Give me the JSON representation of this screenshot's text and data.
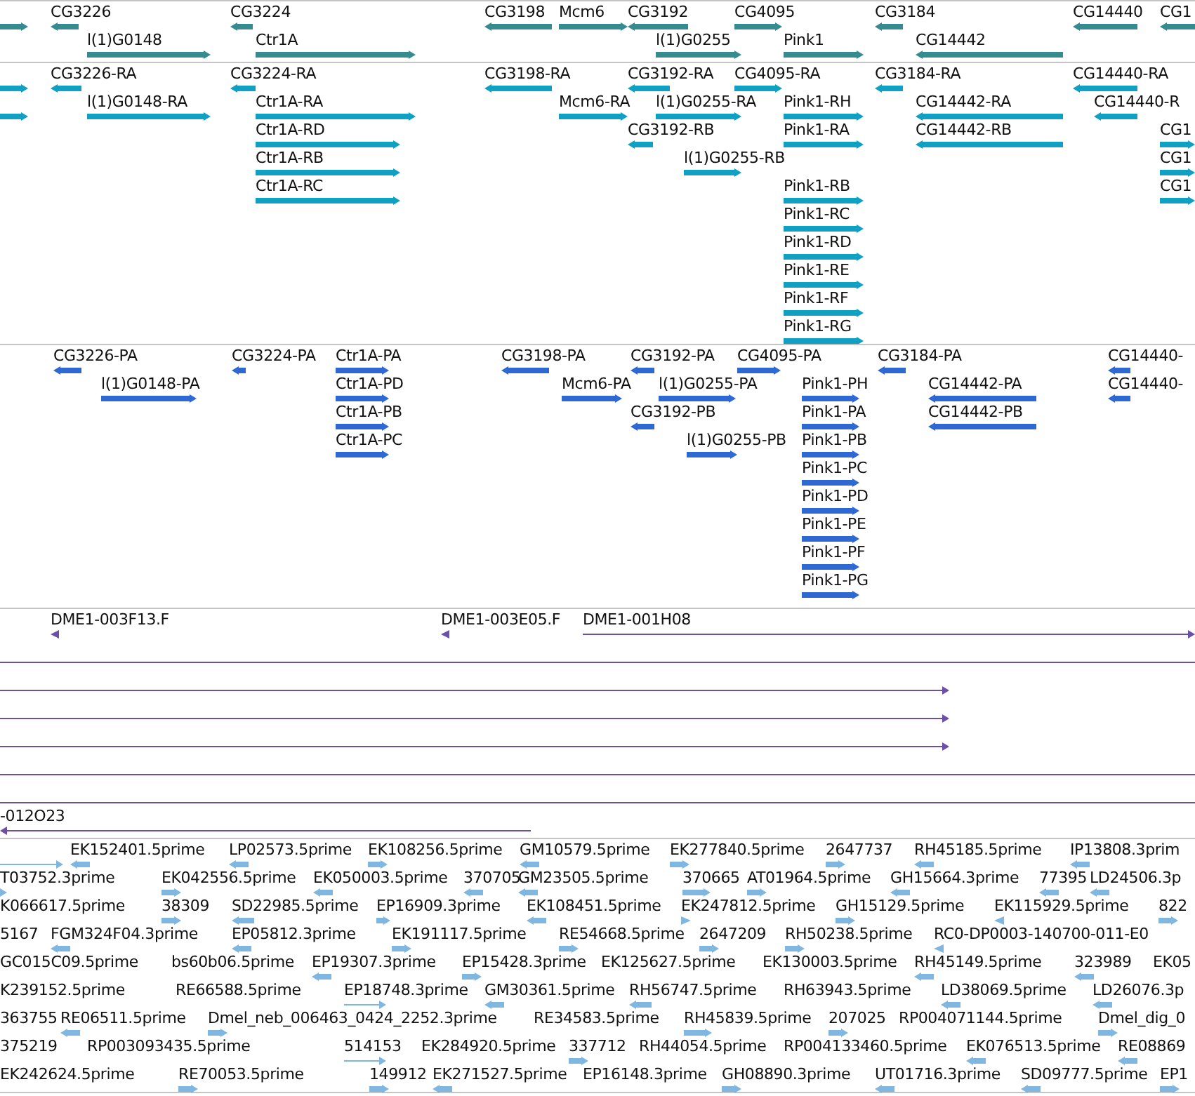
{
  "tracks": [
    {
      "kind": "gene",
      "features": [
        {
          "kind": "forward"
        },
        {
          "label": "CG3226",
          "kind": "reverse"
        },
        {
          "label": "l(1)G0148",
          "kind": "forward"
        },
        {
          "label": "CG3224",
          "kind": "reverse"
        },
        {
          "label": "Ctr1A",
          "kind": "forward"
        },
        {
          "label": "CG3198",
          "kind": "reverse"
        },
        {
          "label": "Mcm6",
          "kind": "forward"
        },
        {
          "label": "CG3192",
          "kind": "reverse"
        },
        {
          "label": "l(1)G0255",
          "kind": "forward"
        },
        {
          "label": "CG4095",
          "kind": "forward"
        },
        {
          "label": "Pink1",
          "kind": "forward"
        },
        {
          "label": "CG3184",
          "kind": "reverse"
        },
        {
          "label": "CG14442",
          "kind": "reverse"
        },
        {
          "label": "CG14440",
          "kind": "reverse"
        },
        {
          "label": "CG1",
          "kind": "reverse"
        }
      ]
    },
    {
      "kind": "transcript",
      "features": [
        {
          "kind": "forward"
        },
        {
          "kind": "forward"
        },
        {
          "label": "CG3226-RA",
          "kind": "reverse"
        },
        {
          "label": "l(1)G0148-RA",
          "kind": "forward"
        },
        {
          "label": "CG3224-RA",
          "kind": "reverse"
        },
        {
          "label": "Ctr1A-RA",
          "kind": "forward"
        },
        {
          "label": "Ctr1A-RD",
          "kind": "forward"
        },
        {
          "label": "Ctr1A-RB",
          "kind": "forward"
        },
        {
          "label": "Ctr1A-RC",
          "kind": "forward"
        },
        {
          "label": "CG3198-RA",
          "kind": "reverse"
        },
        {
          "label": "Mcm6-RA",
          "kind": "forward"
        },
        {
          "label": "CG3192-RA",
          "kind": "reverse"
        },
        {
          "label": "CG4095-RA",
          "kind": "forward"
        },
        {
          "label": "l(1)G0255-RA",
          "kind": "forward"
        },
        {
          "label": "CG3192-RB",
          "kind": "reverse"
        },
        {
          "label": "l(1)G0255-RB",
          "kind": "forward"
        },
        {
          "label": "Pink1-RH",
          "kind": "forward"
        },
        {
          "label": "Pink1-RA",
          "kind": "forward"
        },
        {
          "label": "Pink1-RB",
          "kind": "forward"
        },
        {
          "label": "Pink1-RC",
          "kind": "forward"
        },
        {
          "label": "Pink1-RD",
          "kind": "forward"
        },
        {
          "label": "Pink1-RE",
          "kind": "forward"
        },
        {
          "label": "Pink1-RF",
          "kind": "forward"
        },
        {
          "label": "Pink1-RG",
          "kind": "forward"
        },
        {
          "label": "CG3184-RA",
          "kind": "reverse"
        },
        {
          "label": "CG14442-RA",
          "kind": "reverse"
        },
        {
          "label": "CG14442-RB",
          "kind": "reverse"
        },
        {
          "label": "CG14440-RA",
          "kind": "reverse"
        },
        {
          "label": "CG14440-R",
          "kind": "reverse"
        },
        {
          "label": "CG1",
          "kind": "forward"
        },
        {
          "label": "CG1",
          "kind": "forward"
        },
        {
          "label": "CG1",
          "kind": "forward"
        }
      ]
    },
    {
      "kind": "protein",
      "features": [
        {
          "label": "CG3226-PA",
          "kind": "reverse"
        },
        {
          "label": "l(1)G0148-PA",
          "kind": "forward"
        },
        {
          "label": "CG3224-PA",
          "kind": "reverse"
        },
        {
          "label": "Ctr1A-PA",
          "kind": "forward"
        },
        {
          "label": "Ctr1A-PD",
          "kind": "forward"
        },
        {
          "label": "Ctr1A-PB",
          "kind": "forward"
        },
        {
          "label": "Ctr1A-PC",
          "kind": "forward"
        },
        {
          "label": "CG3198-PA",
          "kind": "reverse"
        },
        {
          "label": "Mcm6-PA",
          "kind": "forward"
        },
        {
          "label": "CG3192-PA",
          "kind": "reverse"
        },
        {
          "label": "CG4095-PA",
          "kind": "forward"
        },
        {
          "label": "l(1)G0255-PA",
          "kind": "forward"
        },
        {
          "label": "CG3192-PB",
          "kind": "reverse"
        },
        {
          "label": "l(1)G0255-PB",
          "kind": "forward"
        },
        {
          "label": "Pink1-PH",
          "kind": "forward"
        },
        {
          "label": "Pink1-PA",
          "kind": "forward"
        },
        {
          "label": "Pink1-PB",
          "kind": "forward"
        },
        {
          "label": "Pink1-PC",
          "kind": "forward"
        },
        {
          "label": "Pink1-PD",
          "kind": "forward"
        },
        {
          "label": "Pink1-PE",
          "kind": "forward"
        },
        {
          "label": "Pink1-PF",
          "kind": "forward"
        },
        {
          "label": "Pink1-PG",
          "kind": "forward"
        },
        {
          "label": "CG3184-PA",
          "kind": "reverse"
        },
        {
          "label": "CG14442-PA",
          "kind": "reverse"
        },
        {
          "label": "CG14442-PB",
          "kind": "reverse"
        },
        {
          "label": "CG14440-",
          "kind": "reverse"
        },
        {
          "label": "CG14440-",
          "kind": "reverse"
        }
      ]
    },
    {
      "kind": "clone",
      "features": [
        {
          "label": "DME1-003F13.F",
          "kind": "reverse"
        },
        {
          "label": "DME1-003E05.F",
          "kind": "reverse"
        },
        {
          "label": "DME1-001H08",
          "kind": "forward"
        },
        {
          "kind": "line"
        },
        {
          "kind": "forward"
        },
        {
          "kind": "forward"
        },
        {
          "kind": "forward"
        },
        {
          "kind": "line"
        },
        {
          "kind": "line"
        },
        {
          "label": "-012O23",
          "kind": "reverse"
        }
      ]
    },
    {
      "kind": "est",
      "features": [
        {
          "kind": "forward"
        },
        {
          "label": "EK152401.5prime",
          "kind": "reverse"
        },
        {
          "label": "LP02573.5prime",
          "kind": "reverse"
        },
        {
          "label": "EK108256.5prime",
          "kind": "forward"
        },
        {
          "label": "GM10579.5prime",
          "kind": "reverse"
        },
        {
          "label": "EK277840.5prime",
          "kind": "forward"
        },
        {
          "label": "2647737",
          "kind": "forward"
        },
        {
          "label": "RH45185.5prime",
          "kind": "reverse"
        },
        {
          "label": "IP13808.3prim",
          "kind": "reverse"
        },
        {
          "label": "T03752.3prime",
          "kind": "forward"
        },
        {
          "label": "EK042556.5prime",
          "kind": "forward"
        },
        {
          "label": "EK050003.5prime",
          "kind": "reverse"
        },
        {
          "label": "370705",
          "kind": "reverse"
        },
        {
          "label": "GM23505.5prime",
          "kind": "reverse"
        },
        {
          "label": "370665",
          "kind": "forward"
        },
        {
          "label": "AT01964.5prime",
          "kind": "forward"
        },
        {
          "label": "GH15664.3prime",
          "kind": "reverse"
        },
        {
          "label": "77395",
          "kind": "reverse"
        },
        {
          "label": "LD24506.3p",
          "kind": "reverse"
        },
        {
          "label": "K066617.5prime",
          "kind": "label"
        },
        {
          "label": "38309",
          "kind": "forward"
        },
        {
          "label": "SD22985.5prime",
          "kind": "reverse"
        },
        {
          "label": "EP16909.3prime",
          "kind": "forward"
        },
        {
          "label": "EK108451.5prime",
          "kind": "reverse"
        },
        {
          "label": "EK247812.5prime",
          "kind": "forward"
        },
        {
          "label": "GH15129.5prime",
          "kind": "forward"
        },
        {
          "label": "EK115929.5prime",
          "kind": "reverse"
        },
        {
          "label": "822",
          "kind": "forward"
        },
        {
          "label": "5167",
          "kind": "label"
        },
        {
          "label": "FGM324F04.3prime",
          "kind": "reverse"
        },
        {
          "label": "EP05812.3prime",
          "kind": "reverse"
        },
        {
          "label": "EK191117.5prime",
          "kind": "forward"
        },
        {
          "label": "RE54668.5prime",
          "kind": "forward"
        },
        {
          "label": "2647209",
          "kind": "forward"
        },
        {
          "label": "RH50238.5prime",
          "kind": "forward"
        },
        {
          "label": "RC0-DP0003-140700-011-E0",
          "kind": "reverse"
        },
        {
          "label": "GC015C09.5prime",
          "kind": "label"
        },
        {
          "label": "bs60b06.5prime",
          "kind": "label"
        },
        {
          "label": "EP19307.3prime",
          "kind": "reverse"
        },
        {
          "label": "EP15428.3prime",
          "kind": "forward"
        },
        {
          "label": "EK125627.5prime",
          "kind": "label"
        },
        {
          "label": "EK130003.5prime",
          "kind": "label"
        },
        {
          "label": "RH45149.5prime",
          "kind": "reverse"
        },
        {
          "label": "323989",
          "kind": "reverse"
        },
        {
          "label": "EK05",
          "kind": "label"
        },
        {
          "label": "K239152.5prime",
          "kind": "label"
        },
        {
          "label": "RE66588.5prime",
          "kind": "label"
        },
        {
          "label": "EP18748.3prime",
          "kind": "forward"
        },
        {
          "label": "GM30361.5prime",
          "kind": "reverse"
        },
        {
          "label": "RH56747.5prime",
          "kind": "reverse"
        },
        {
          "label": "RH63943.5prime",
          "kind": "label"
        },
        {
          "label": "LD38069.5prime",
          "kind": "reverse"
        },
        {
          "label": "LD26076.3p",
          "kind": "reverse"
        },
        {
          "label": "363755",
          "kind": "label"
        },
        {
          "label": "RE06511.5prime",
          "kind": "reverse"
        },
        {
          "label": "Dmel_neb_006463_0424_2252.3prime",
          "kind": "forward"
        },
        {
          "label": "RE34583.5prime",
          "kind": "label"
        },
        {
          "label": "RH45839.5prime",
          "kind": "forward"
        },
        {
          "label": "207025",
          "kind": "forward"
        },
        {
          "label": "RP004071144.5prime",
          "kind": "label"
        },
        {
          "label": "Dmel_dig_0",
          "kind": "forward"
        },
        {
          "label": "375219",
          "kind": "label"
        },
        {
          "label": "RP003093435.5prime",
          "kind": "label"
        },
        {
          "label": "514153",
          "kind": "forward"
        },
        {
          "label": "EK284920.5prime",
          "kind": "label"
        },
        {
          "label": "337712",
          "kind": "forward"
        },
        {
          "label": "RH44054.5prime",
          "kind": "label"
        },
        {
          "label": "RP004133460.5prime",
          "kind": "label"
        },
        {
          "label": "EK076513.5prime",
          "kind": "reverse"
        },
        {
          "label": "RE08869",
          "kind": "reverse"
        },
        {
          "label": "EK242624.5prime",
          "kind": "label"
        },
        {
          "label": "RE70053.5prime",
          "kind": "forward"
        },
        {
          "label": "149912",
          "kind": "forward"
        },
        {
          "label": "EK271527.5prime",
          "kind": "reverse"
        },
        {
          "label": "EP16148.3prime",
          "kind": "label"
        },
        {
          "label": "GH08890.3prime",
          "kind": "forward"
        },
        {
          "label": "UT01716.3prime",
          "kind": "reverse"
        },
        {
          "label": "SD09777.5prime",
          "kind": "reverse"
        },
        {
          "label": "EP1",
          "kind": "forward"
        }
      ]
    }
  ]
}
